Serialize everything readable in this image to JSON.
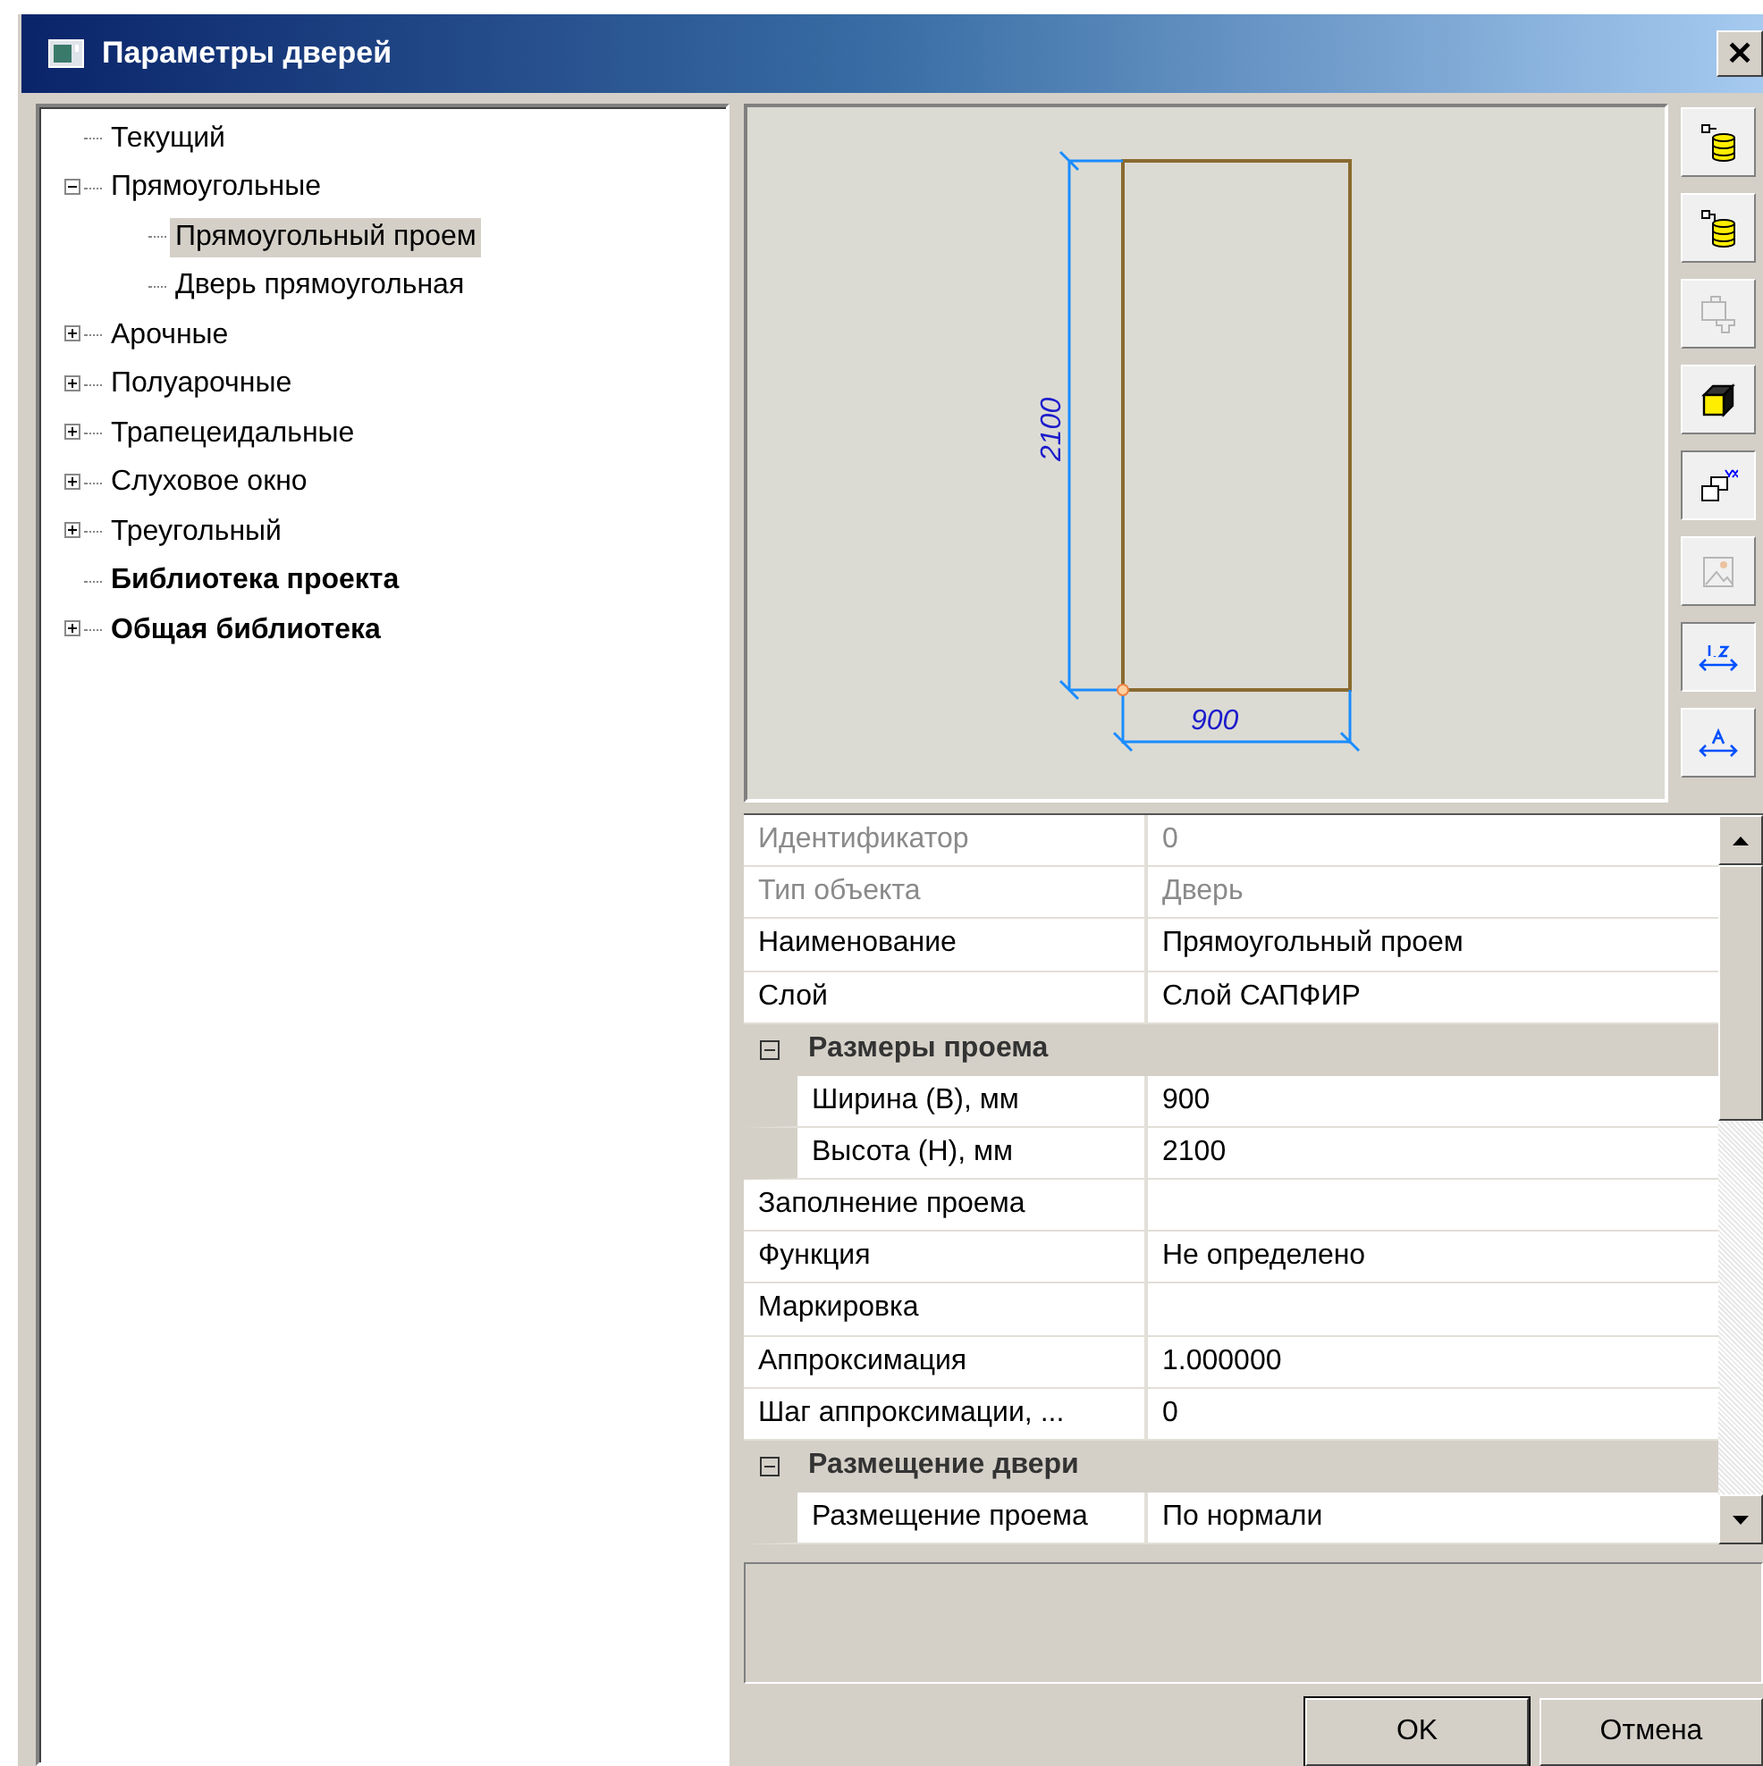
{
  "window": {
    "title": "Параметры дверей",
    "close": "✕"
  },
  "tree": [
    {
      "label": "Текущий",
      "bold": false,
      "selected": false
    },
    {
      "label": "Прямоугольные",
      "bold": false,
      "selected": false,
      "expanded": true,
      "children": [
        {
          "label": "Прямоугольный проем",
          "bold": false,
          "selected": true
        },
        {
          "label": "Дверь прямоугольная",
          "bold": false,
          "selected": false
        }
      ]
    },
    {
      "label": "Арочные",
      "bold": false,
      "selected": false,
      "expanded": false
    },
    {
      "label": "Полуарочные",
      "bold": false,
      "selected": false,
      "expanded": false
    },
    {
      "label": "Трапецеидальные",
      "bold": false,
      "selected": false,
      "expanded": false
    },
    {
      "label": "Слуховое окно",
      "bold": false,
      "selected": false,
      "expanded": false
    },
    {
      "label": "Треугольный",
      "bold": false,
      "selected": false,
      "expanded": false
    },
    {
      "label": "Библиотека проекта",
      "bold": true,
      "selected": false
    },
    {
      "label": "Общая библиотека",
      "bold": true,
      "selected": false,
      "expanded": false
    }
  ],
  "preview": {
    "height_label": "2100",
    "width_label": "900"
  },
  "toolbar": [
    {
      "kind": "db-out",
      "disabled": false,
      "pressed": false
    },
    {
      "kind": "db-in",
      "disabled": false,
      "pressed": false
    },
    {
      "kind": "parts",
      "disabled": true,
      "pressed": false
    },
    {
      "kind": "cube",
      "disabled": false,
      "pressed": false
    },
    {
      "kind": "xy",
      "disabled": false,
      "pressed": true
    },
    {
      "kind": "image",
      "disabled": true,
      "pressed": false
    },
    {
      "kind": "dim-num",
      "disabled": false,
      "pressed": true
    },
    {
      "kind": "dim-text",
      "disabled": false,
      "pressed": false
    }
  ],
  "properties": [
    {
      "kind": "row",
      "name": "Идентификатор",
      "value": "0",
      "disabled": true
    },
    {
      "kind": "row",
      "name": "Тип объекта",
      "value": "Дверь",
      "disabled": true
    },
    {
      "kind": "row",
      "name": "Наименование",
      "value": "Прямоугольный проем",
      "disabled": false
    },
    {
      "kind": "row",
      "name": "Слой",
      "value": "Слой САПФИР",
      "disabled": false
    },
    {
      "kind": "group",
      "name": "Размеры проема",
      "expanded": true,
      "children": [
        {
          "kind": "row",
          "name": "Ширина (B), мм",
          "value": "900",
          "disabled": false
        },
        {
          "kind": "row",
          "name": "Высота (H), мм",
          "value": "2100",
          "disabled": false
        }
      ]
    },
    {
      "kind": "row",
      "name": "Заполнение проема",
      "disabled": false
    },
    {
      "kind": "row",
      "name": "Функция",
      "value": "Не определено",
      "disabled": false
    },
    {
      "kind": "row",
      "name": "Маркировка",
      "disabled": false
    },
    {
      "kind": "row",
      "name": "Аппроксимация",
      "value": "1.000000",
      "disabled": false
    },
    {
      "kind": "row",
      "name": "Шаг аппроксимации, ...",
      "value": "0",
      "disabled": false
    },
    {
      "kind": "group",
      "name": "Размещение двери",
      "expanded": true,
      "children": [
        {
          "kind": "row",
          "name": "Размещение проема",
          "value": "По нормали",
          "disabled": false
        }
      ]
    }
  ],
  "buttons": [
    {
      "label": "OK",
      "default": true
    },
    {
      "label": "Отмена",
      "default": false
    }
  ]
}
